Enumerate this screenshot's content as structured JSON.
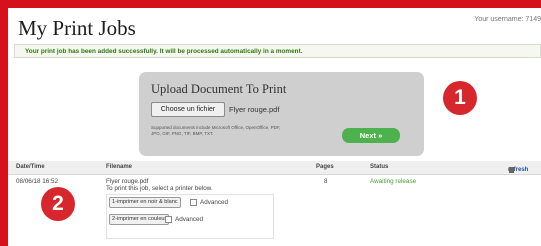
{
  "header": {
    "title": "My Print Jobs",
    "username_text": "Your username: 7149"
  },
  "success_message": "Your print job has been added successfully. It will be processed automatically in a moment.",
  "upload": {
    "title": "Upload Document To Print",
    "choose_label": "Choose un fichier",
    "file_name": "Flyer rouge.pdf",
    "supported_text": "Supported documents include Microsoft Office, OpenOffice, PDF, JPG, GIF, PNG, TIF, BMP, TXT.",
    "next_label": "Next »"
  },
  "badges": [
    "1",
    "2"
  ],
  "table": {
    "columns": [
      "Date/Time",
      "Filename",
      "Pages",
      "Status"
    ],
    "refresh_label": "refresh",
    "rows": [
      {
        "datetime": "08/06/18 16:52",
        "filename": "Flyer rouge.pdf",
        "pages": "8",
        "status": "Awaiting release"
      }
    ],
    "instructions": "To print this job, select a printer below.",
    "printers": [
      {
        "label": "1-imprimer en noir & blanc",
        "advanced_label": "Advanced"
      },
      {
        "label": "2-imprimer en couleur",
        "advanced_label": "Advanced"
      }
    ]
  },
  "colors": {
    "frame": "#d5121c",
    "success_text": "#2c7a0e",
    "next_button": "#4db24d",
    "badge": "#d8262d",
    "status": "#4aa234"
  }
}
